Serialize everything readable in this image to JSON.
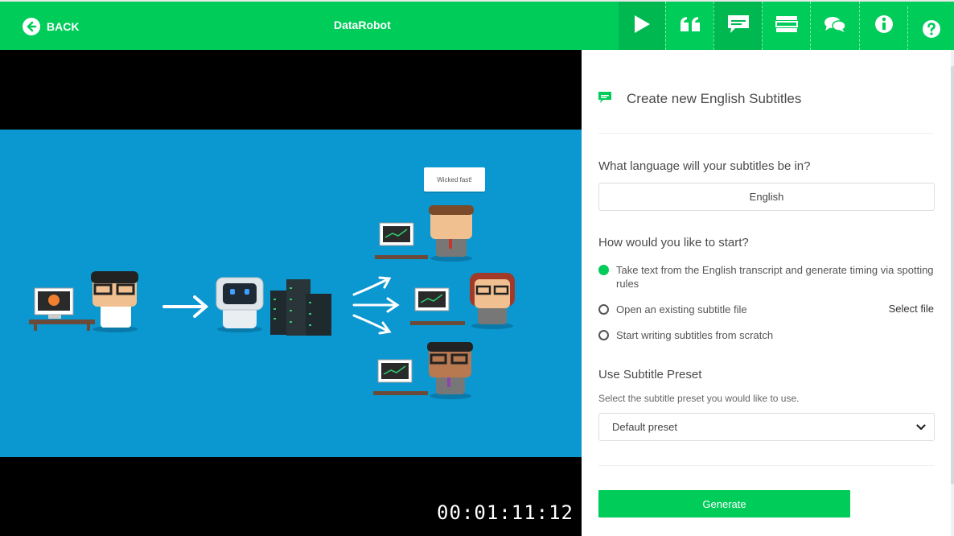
{
  "header": {
    "back_label": "BACK",
    "title": "DataRobot",
    "toolbar": [
      {
        "name": "play-icon",
        "active": true
      },
      {
        "name": "quote-icon",
        "active": false
      },
      {
        "name": "subtitle-icon",
        "active": true
      },
      {
        "name": "layout-icon",
        "active": false
      },
      {
        "name": "comments-icon",
        "active": false
      },
      {
        "name": "info-icon",
        "active": false
      },
      {
        "name": "help-icon",
        "active": false
      }
    ],
    "colors": {
      "brand": "#00cc5a",
      "active": "#00b850"
    }
  },
  "video": {
    "timecode": "00:01:11:12",
    "speech_bubble": "Wicked fast!",
    "background": "#0b97cf"
  },
  "panel": {
    "title": "Create new English Subtitles",
    "language_question": "What language will your subtitles be in?",
    "language_value": "English",
    "start_question": "How would you like to start?",
    "options": [
      {
        "label": "Take text from the English transcript and generate timing via spotting rules",
        "selected": true
      },
      {
        "label": "Open an existing subtitle file",
        "selected": false
      },
      {
        "label": "Start writing subtitles from scratch",
        "selected": false
      }
    ],
    "select_file_label": "Select file",
    "preset_heading": "Use Subtitle Preset",
    "preset_hint": "Select the subtitle preset you would like to use.",
    "preset_value": "Default preset",
    "generate_label": "Generate"
  }
}
